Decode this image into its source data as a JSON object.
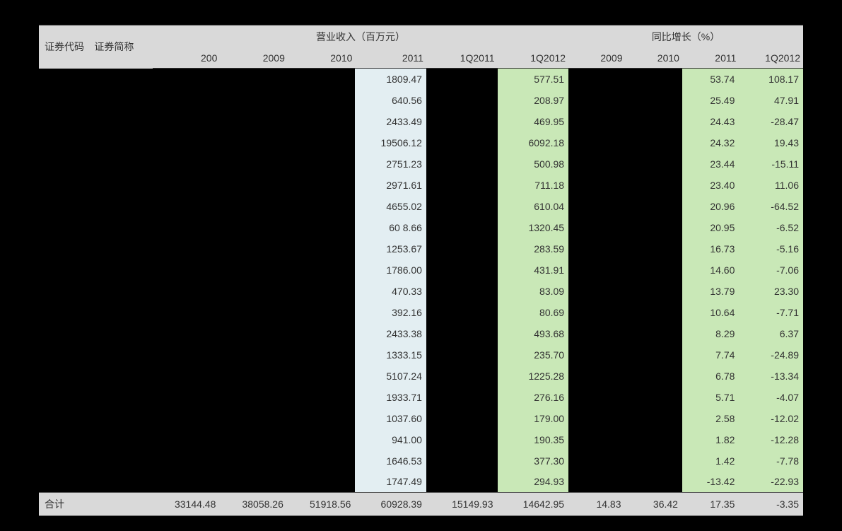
{
  "header": {
    "code": "证券代码",
    "name": "证券简称",
    "group_rev": "营业收入（百万元）",
    "group_yoy": "同比增长（%）",
    "rev_cols": [
      "200",
      "2009",
      "2010",
      "2011",
      "1Q2011",
      "1Q2012"
    ],
    "yoy_cols": [
      "2009",
      "2010",
      "2011",
      "1Q2012"
    ]
  },
  "chart_data": {
    "type": "table",
    "title": "营业收入 & 同比增长",
    "columns": [
      "证券代码",
      "证券简称",
      "200",
      "2009",
      "2010",
      "2011",
      "1Q2011",
      "1Q2012",
      "2009增长",
      "2010增长",
      "2011增长",
      "1Q2012增长"
    ],
    "rows": [
      {
        "rev2011": "1809.47",
        "q12012": "577.51",
        "yoy2011": "53.74",
        "yoyq12012": "108.17"
      },
      {
        "rev2011": "640.56",
        "q12012": "208.97",
        "yoy2011": "25.49",
        "yoyq12012": "47.91"
      },
      {
        "rev2011": "2433.49",
        "q12012": "469.95",
        "yoy2011": "24.43",
        "yoyq12012": "-28.47"
      },
      {
        "rev2011": "19506.12",
        "q12012": "6092.18",
        "yoy2011": "24.32",
        "yoyq12012": "19.43"
      },
      {
        "rev2011": "2751.23",
        "q12012": "500.98",
        "yoy2011": "23.44",
        "yoyq12012": "-15.11"
      },
      {
        "rev2011": "2971.61",
        "q12012": "711.18",
        "yoy2011": "23.40",
        "yoyq12012": "11.06"
      },
      {
        "rev2011": "4655.02",
        "q12012": "610.04",
        "yoy2011": "20.96",
        "yoyq12012": "-64.52"
      },
      {
        "rev2011": "60 8.66",
        "q12012": "1320.45",
        "yoy2011": "20.95",
        "yoyq12012": "-6.52"
      },
      {
        "rev2011": "1253.67",
        "q12012": "283.59",
        "yoy2011": "16.73",
        "yoyq12012": "-5.16"
      },
      {
        "rev2011": "1786.00",
        "q12012": "431.91",
        "yoy2011": "14.60",
        "yoyq12012": "-7.06"
      },
      {
        "rev2011": "470.33",
        "q12012": "83.09",
        "yoy2011": "13.79",
        "yoyq12012": "23.30"
      },
      {
        "rev2011": "392.16",
        "q12012": "80.69",
        "yoy2011": "10.64",
        "yoyq12012": "-7.71"
      },
      {
        "rev2011": "2433.38",
        "q12012": "493.68",
        "yoy2011": "8.29",
        "yoyq12012": "6.37"
      },
      {
        "rev2011": "1333.15",
        "q12012": "235.70",
        "yoy2011": "7.74",
        "yoyq12012": "-24.89"
      },
      {
        "rev2011": "5107.24",
        "q12012": "1225.28",
        "yoy2011": "6.78",
        "yoyq12012": "-13.34"
      },
      {
        "rev2011": "1933.71",
        "q12012": "276.16",
        "yoy2011": "5.71",
        "yoyq12012": "-4.07"
      },
      {
        "rev2011": "1037.60",
        "q12012": "179.00",
        "yoy2011": "2.58",
        "yoyq12012": "-12.02"
      },
      {
        "rev2011": "941.00",
        "q12012": "190.35",
        "yoy2011": "1.82",
        "yoyq12012": "-12.28"
      },
      {
        "rev2011": "1646.53",
        "q12012": "377.30",
        "yoy2011": "1.42",
        "yoyq12012": "-7.78"
      },
      {
        "rev2011": "1747.49",
        "q12012": "294.93",
        "yoy2011": "-13.42",
        "yoyq12012": "-22.93"
      }
    ],
    "totals": {
      "label": "合计",
      "rev200": "33144.48",
      "rev2009": "38058.26",
      "rev2010": "51918.56",
      "rev2011": "60928.39",
      "q12011": "15149.93",
      "q12012": "14642.95",
      "yoy2009": "14.83",
      "yoy2010": "36.42",
      "yoy2011": "17.35",
      "yoyq12012": "-3.35"
    }
  }
}
